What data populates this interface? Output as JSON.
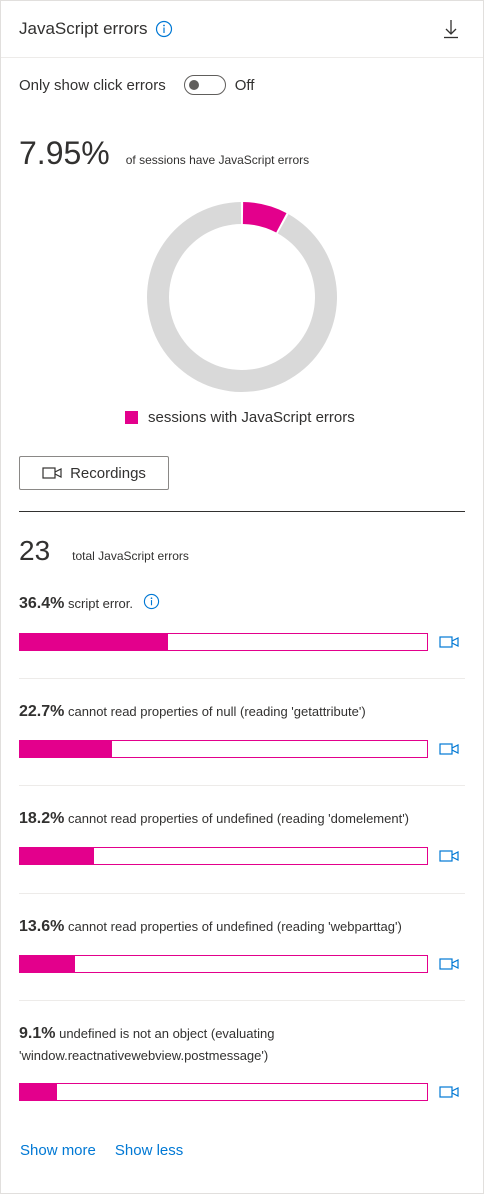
{
  "header": {
    "title": "JavaScript errors",
    "info_icon": "info-icon",
    "download_icon": "download-icon"
  },
  "filter": {
    "label": "Only show click errors",
    "state": "Off"
  },
  "summary": {
    "percent": "7.95%",
    "description": "of sessions have JavaScript errors"
  },
  "chart_data": {
    "type": "pie",
    "variant": "donut",
    "slices": [
      {
        "label": "sessions with JavaScript errors",
        "value": 7.95,
        "color": "#e3008c"
      },
      {
        "value": 92.05,
        "color": "#d9d9d9"
      }
    ],
    "legend": "bottom"
  },
  "legend": {
    "label": "sessions with JavaScript errors"
  },
  "recordings_button": {
    "label": "Recordings"
  },
  "totals": {
    "count": "23",
    "description": "total JavaScript errors"
  },
  "errors": [
    {
      "percent": "36.4%",
      "text": "script error.",
      "fraction": 0.364
    },
    {
      "percent": "22.7%",
      "text": "cannot read properties of null (reading 'getattribute')",
      "fraction": 0.227
    },
    {
      "percent": "18.2%",
      "text": "cannot read properties of undefined (reading 'domelement')",
      "fraction": 0.182
    },
    {
      "percent": "13.6%",
      "text": "cannot read properties of undefined (reading 'webparttag')",
      "fraction": 0.136
    },
    {
      "percent": "9.1%",
      "text": "undefined is not an object (evaluating 'window.reactnativewebview.postmessage')",
      "fraction": 0.091
    }
  ],
  "links": {
    "show_more": "Show more",
    "show_less": "Show less"
  },
  "colors": {
    "accent": "#e3008c",
    "link": "#0078d4",
    "track": "#d9d9d9"
  }
}
